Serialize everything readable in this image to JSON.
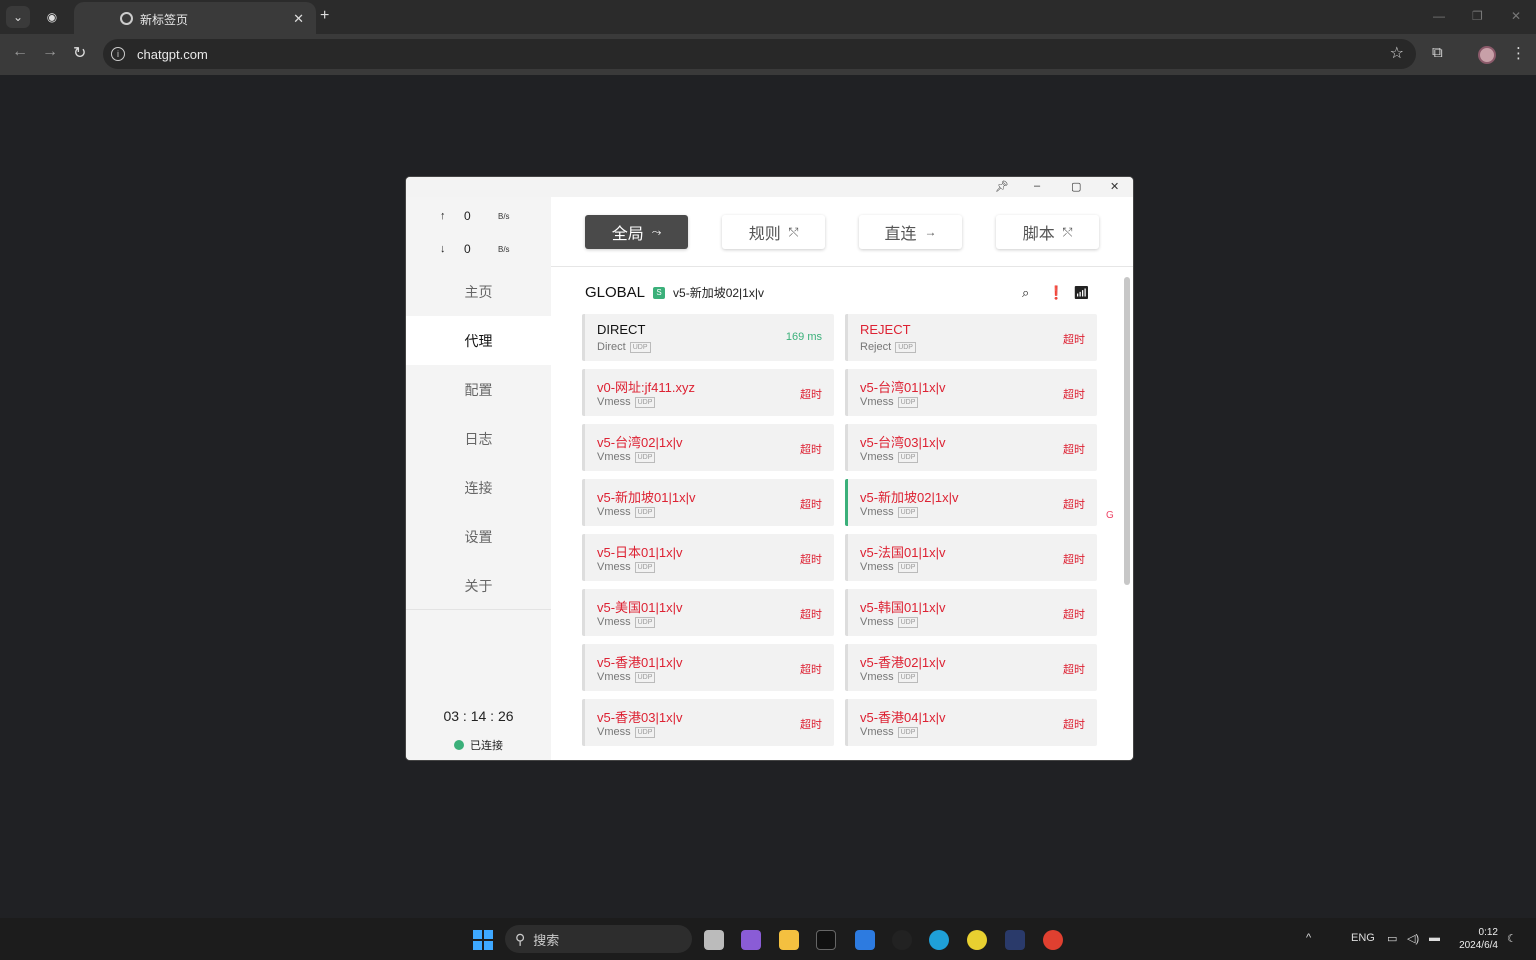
{
  "browser": {
    "tab_title": "新标签页",
    "url": "chatgpt.com"
  },
  "app": {
    "traffic": {
      "up_arrow": "↑",
      "up": "0",
      "down_arrow": "↓",
      "down": "0",
      "unit": "B/s"
    },
    "nav": [
      "主页",
      "代理",
      "配置",
      "日志",
      "连接",
      "设置",
      "关于"
    ],
    "active_nav": "代理",
    "timer": "03 : 14 : 26",
    "status": "已连接",
    "modes": [
      {
        "label": "全局",
        "icon": "⤳",
        "active": true
      },
      {
        "label": "规则",
        "icon": "⤲",
        "active": false
      },
      {
        "label": "直连",
        "icon": "→",
        "active": false
      },
      {
        "label": "脚本",
        "icon": "⤲",
        "active": false
      }
    ],
    "group": {
      "name": "GLOBAL",
      "badge": "S",
      "selected": "v5-新加坡02|1x|v"
    },
    "right_mark": "G",
    "proxies": [
      {
        "name": "DIRECT",
        "type": "Direct",
        "udp": "UDP",
        "delay": "169 ms",
        "ok": true
      },
      {
        "name": "REJECT",
        "type": "Reject",
        "udp": "UDP",
        "delay": "超时",
        "ok": false
      },
      {
        "name": "v0-网址:jf411.xyz",
        "type": "Vmess",
        "udp": "UDP",
        "delay": "超时",
        "ok": false
      },
      {
        "name": "v5-台湾01|1x|v",
        "type": "Vmess",
        "udp": "UDP",
        "delay": "超时",
        "ok": false
      },
      {
        "name": "v5-台湾02|1x|v",
        "type": "Vmess",
        "udp": "UDP",
        "delay": "超时",
        "ok": false
      },
      {
        "name": "v5-台湾03|1x|v",
        "type": "Vmess",
        "udp": "UDP",
        "delay": "超时",
        "ok": false
      },
      {
        "name": "v5-新加坡01|1x|v",
        "type": "Vmess",
        "udp": "UDP",
        "delay": "超时",
        "ok": false
      },
      {
        "name": "v5-新加坡02|1x|v",
        "type": "Vmess",
        "udp": "UDP",
        "delay": "超时",
        "ok": false,
        "selected": true
      },
      {
        "name": "v5-日本01|1x|v",
        "type": "Vmess",
        "udp": "UDP",
        "delay": "超时",
        "ok": false
      },
      {
        "name": "v5-法国01|1x|v",
        "type": "Vmess",
        "udp": "UDP",
        "delay": "超时",
        "ok": false
      },
      {
        "name": "v5-美国01|1x|v",
        "type": "Vmess",
        "udp": "UDP",
        "delay": "超时",
        "ok": false
      },
      {
        "name": "v5-韩国01|1x|v",
        "type": "Vmess",
        "udp": "UDP",
        "delay": "超时",
        "ok": false
      },
      {
        "name": "v5-香港01|1x|v",
        "type": "Vmess",
        "udp": "UDP",
        "delay": "超时",
        "ok": false
      },
      {
        "name": "v5-香港02|1x|v",
        "type": "Vmess",
        "udp": "UDP",
        "delay": "超时",
        "ok": false
      },
      {
        "name": "v5-香港03|1x|v",
        "type": "Vmess",
        "udp": "UDP",
        "delay": "超时",
        "ok": false
      },
      {
        "name": "v5-香港04|1x|v",
        "type": "Vmess",
        "udp": "UDP",
        "delay": "超时",
        "ok": false
      }
    ]
  },
  "taskbar": {
    "search_placeholder": "搜索",
    "lang": "ENG",
    "time": "0:12",
    "date": "2024/6/4"
  }
}
